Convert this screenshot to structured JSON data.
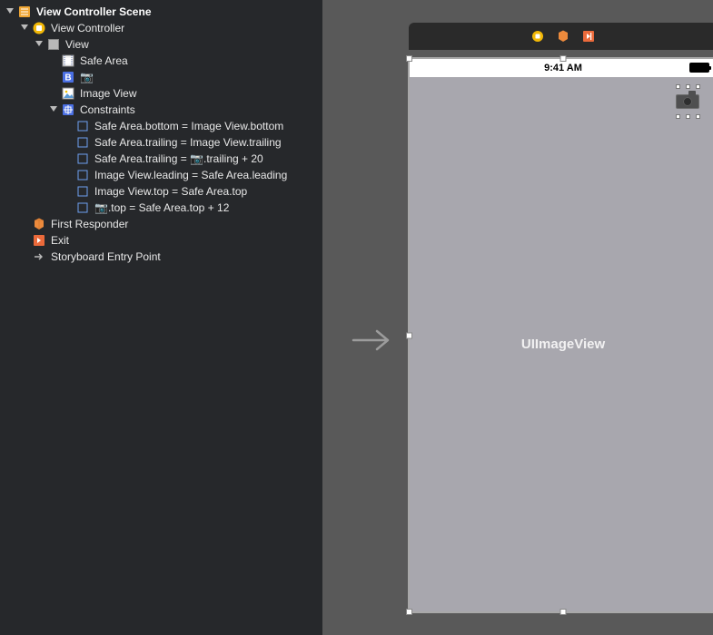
{
  "outline": {
    "scene": "View Controller Scene",
    "vc": "View Controller",
    "view": "View",
    "safe_area": "Safe Area",
    "button_item": "📷",
    "image_view": "Image View",
    "constraints_group": "Constraints",
    "constraints": [
      "Safe Area.bottom = Image View.bottom",
      "Safe Area.trailing = Image View.trailing",
      "Safe Area.trailing = 📷.trailing + 20",
      "Image View.leading = Safe Area.leading",
      "Image View.top = Safe Area.top",
      "📷.top = Safe Area.top + 12"
    ],
    "first_responder": "First Responder",
    "exit": "Exit",
    "entry_point": "Storyboard Entry Point"
  },
  "canvas": {
    "status_time": "9:41 AM",
    "imageview_placeholder": "UIImageView"
  },
  "chart_data": null
}
